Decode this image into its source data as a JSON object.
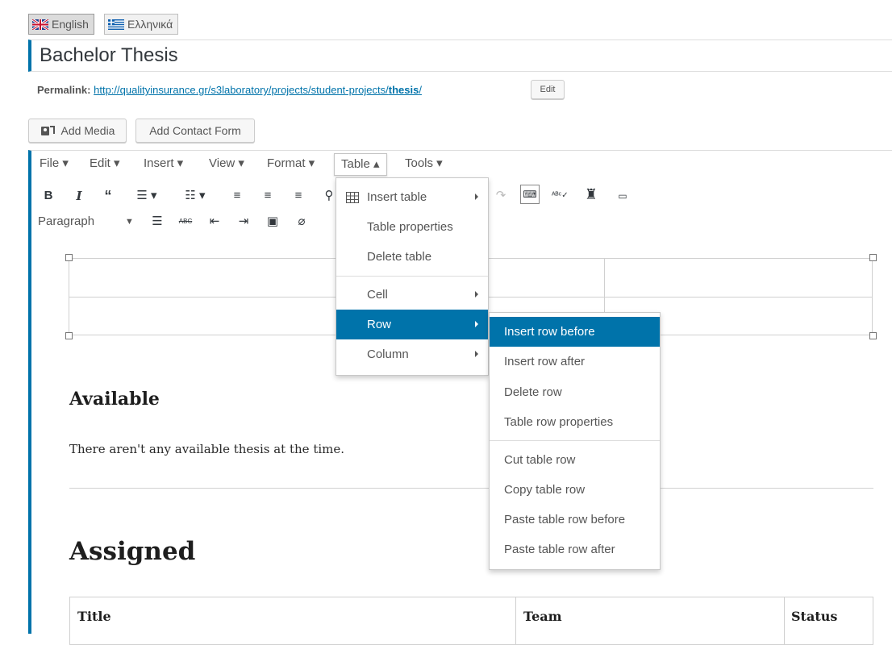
{
  "languages": [
    {
      "label": "English",
      "active": true
    },
    {
      "label": "Ελληνικά",
      "active": false
    }
  ],
  "title": "Bachelor Thesis",
  "permalink": {
    "label": "Permalink:",
    "url_prefix": "http://qualityinsurance.gr/s3laboratory/projects/student-projects/",
    "url_slug": "thesis",
    "url_suffix": "/",
    "edit_label": "Edit"
  },
  "media_buttons": {
    "add_media": "Add Media",
    "add_contact_form": "Add Contact Form"
  },
  "menubar": {
    "file": "File ▾",
    "edit": "Edit ▾",
    "insert": "Insert ▾",
    "view": "View ▾",
    "format": "Format ▾",
    "table": "Table ▴",
    "tools": "Tools ▾"
  },
  "toolbar": {
    "format_select": "Paragraph"
  },
  "table_menu": {
    "items": [
      "Insert table",
      "Table properties",
      "Delete table",
      "Cell",
      "Row",
      "Column"
    ],
    "highlighted": "Row"
  },
  "row_submenu": {
    "items": [
      "Insert row before",
      "Insert row after",
      "Delete row",
      "Table row properties",
      "Cut table row",
      "Copy table row",
      "Paste table row before",
      "Paste table row after"
    ],
    "highlighted": "Insert row before"
  },
  "content": {
    "available_heading": "Available",
    "available_text": "There aren't any available thesis at the time.",
    "assigned_heading": "Assigned",
    "table_headers": [
      "Title",
      "Team",
      "Status"
    ]
  },
  "colors": {
    "accent": "#0073aa"
  }
}
